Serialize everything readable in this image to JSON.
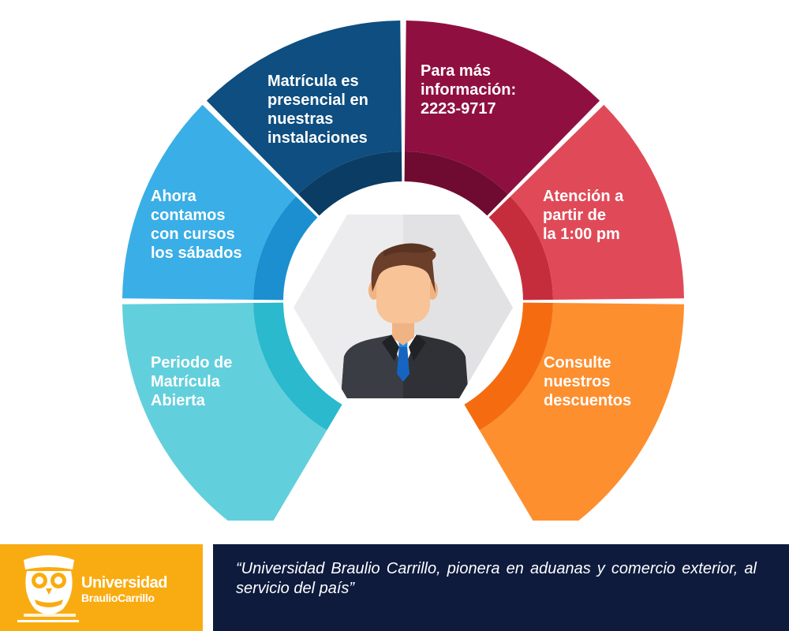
{
  "segments": [
    {
      "id": "matricula-abierta",
      "color": "#62cfdc",
      "dark": "#2ab9cd",
      "lines": [
        "Periodo de",
        "Matrícula",
        "Abierta"
      ]
    },
    {
      "id": "cursos-sabados",
      "color": "#3aaee6",
      "dark": "#1b8fd0",
      "lines": [
        "Ahora",
        "contamos",
        "con cursos",
        "los sábados"
      ]
    },
    {
      "id": "matricula-presencial",
      "color": "#0e4e80",
      "dark": "#0b3c63",
      "lines": [
        "Matrícula es",
        "presencial en",
        "nuestras",
        "instalaciones"
      ]
    },
    {
      "id": "mas-informacion",
      "color": "#8f1040",
      "dark": "#6f0b30",
      "lines": [
        "Para más",
        "información:",
        "2223-9717"
      ]
    },
    {
      "id": "horario-atencion",
      "color": "#e04a58",
      "dark": "#c62d3c",
      "lines": [
        "Atención a",
        "partir de",
        "la 1:00 pm"
      ]
    },
    {
      "id": "descuentos",
      "color": "#fd8f2f",
      "dark": "#f56c10",
      "lines": [
        "Consulte",
        "nuestros",
        "descuentos"
      ]
    }
  ],
  "center_icon": "businessman-icon",
  "footer": {
    "logo": {
      "line1": "Universidad",
      "line2": "BraulioCarrillo",
      "icon": "owl-logo-icon",
      "bg": "#f9ac11"
    },
    "quote": "“Universidad Braulio Carrillo, pionera en aduanas y comercio exterior, al servicio del país”",
    "quote_bg": "#0e1b3d"
  }
}
